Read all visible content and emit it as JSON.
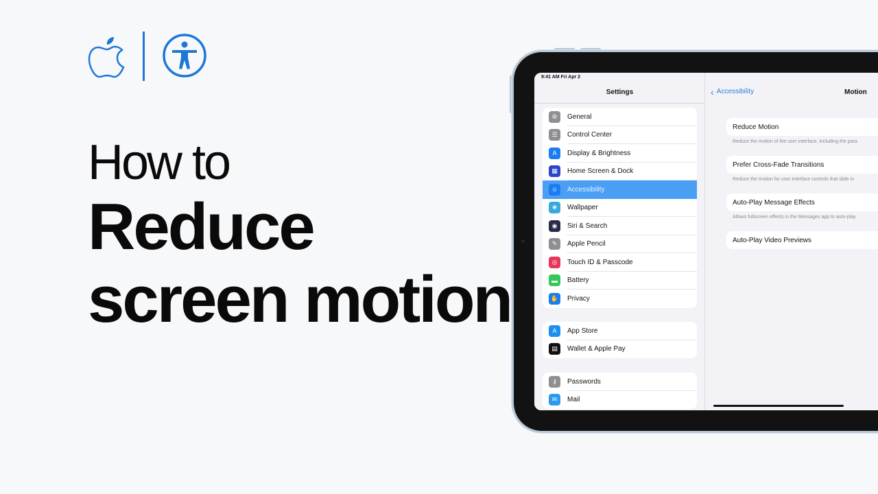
{
  "branding": {
    "logo": "apple-logo",
    "accessibility_logo": "accessibility-icon",
    "accent_color": "#1d77d6"
  },
  "headline": {
    "line1": "How to",
    "line2": "Reduce",
    "line3": "screen motion"
  },
  "device": {
    "status_bar": "9:41 AM   Fri Apr 2",
    "sidebar": {
      "title": "Settings",
      "groups": [
        {
          "items": [
            {
              "label": "General",
              "icon": "gear-icon",
              "color": "#8e8e93"
            },
            {
              "label": "Control Center",
              "icon": "toggles-icon",
              "color": "#8e8e93"
            },
            {
              "label": "Display & Brightness",
              "icon": "text-size-icon",
              "color": "#1c7cf2"
            },
            {
              "label": "Home Screen & Dock",
              "icon": "grid-icon",
              "color": "#2b46c7"
            },
            {
              "label": "Accessibility",
              "icon": "accessibility-icon",
              "color": "#1c7cf2",
              "selected": true
            },
            {
              "label": "Wallpaper",
              "icon": "flower-icon",
              "color": "#36aadc"
            },
            {
              "label": "Siri & Search",
              "icon": "siri-icon",
              "color": "#2a2a4a"
            },
            {
              "label": "Apple Pencil",
              "icon": "pencil-icon",
              "color": "#8e8e93"
            },
            {
              "label": "Touch ID & Passcode",
              "icon": "fingerprint-icon",
              "color": "#e8365a"
            },
            {
              "label": "Battery",
              "icon": "battery-icon",
              "color": "#34c759"
            },
            {
              "label": "Privacy",
              "icon": "hand-icon",
              "color": "#1c7cf2"
            }
          ]
        },
        {
          "items": [
            {
              "label": "App Store",
              "icon": "app-store-icon",
              "color": "#1c8ef2"
            },
            {
              "label": "Wallet & Apple Pay",
              "icon": "wallet-icon",
              "color": "#111111"
            }
          ]
        },
        {
          "items": [
            {
              "label": "Passwords",
              "icon": "key-icon",
              "color": "#8e8e93"
            },
            {
              "label": "Mail",
              "icon": "mail-icon",
              "color": "#2a9af3"
            }
          ]
        }
      ]
    },
    "detail": {
      "back_label": "Accessibility",
      "title": "Motion",
      "settings": [
        {
          "label": "Reduce Motion",
          "footnote": "Reduce the motion of the user interface, including the para"
        },
        {
          "label": "Prefer Cross-Fade Transitions",
          "footnote": "Reduce the motion for user interface controls that slide in"
        },
        {
          "label": "Auto-Play Message Effects",
          "footnote": "Allows fullscreen effects in the Messages app to auto-play"
        },
        {
          "label": "Auto-Play Video Previews",
          "footnote": ""
        }
      ]
    }
  }
}
